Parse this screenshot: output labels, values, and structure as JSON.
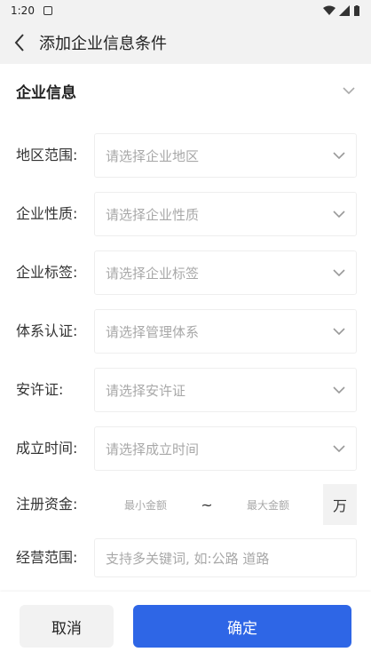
{
  "status_bar": {
    "time": "1:20"
  },
  "header": {
    "title": "添加企业信息条件"
  },
  "section": {
    "title": "企业信息"
  },
  "fields": [
    {
      "label": "地区范围:",
      "placeholder": "请选择企业地区"
    },
    {
      "label": "企业性质:",
      "placeholder": "请选择企业性质"
    },
    {
      "label": "企业标签:",
      "placeholder": "请选择企业标签"
    },
    {
      "label": "体系认证:",
      "placeholder": "请选择管理体系"
    },
    {
      "label": "安许证:",
      "placeholder": "请选择安许证"
    },
    {
      "label": "成立时间:",
      "placeholder": "请选择成立时间"
    }
  ],
  "capital": {
    "label": "注册资金:",
    "min_placeholder": "最小金额",
    "separator": "~",
    "max_placeholder": "最大金额",
    "unit": "万"
  },
  "business_scope": {
    "label": "经营范围:",
    "placeholder": "支持多关键词, 如:公路 道路"
  },
  "footer": {
    "cancel_label": "取消",
    "confirm_label": "确定"
  },
  "colors": {
    "primary": "#2e66e6",
    "header_bg": "#f2f2f2",
    "placeholder": "#a8a8a8"
  }
}
